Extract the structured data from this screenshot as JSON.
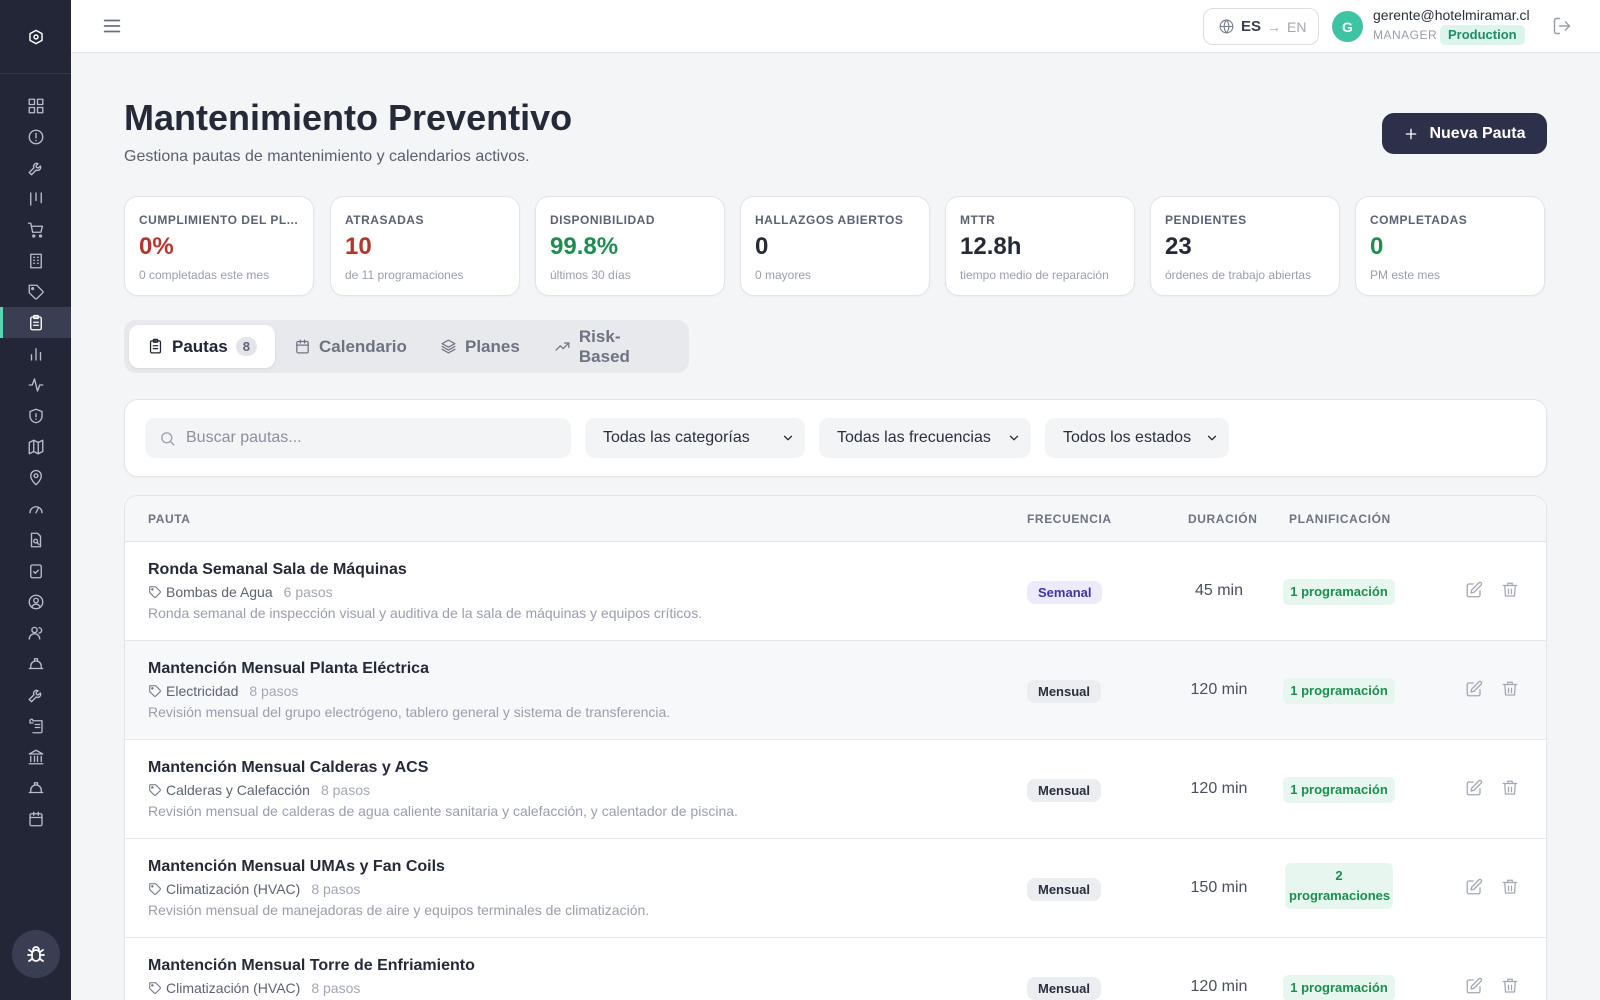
{
  "topbar": {
    "lang_current": "ES",
    "lang_arrow": "→",
    "lang_next": "EN",
    "avatar_initial": "G",
    "user_email": "gerente@hotelmiramar.cl",
    "user_role": "MANAGER",
    "env_badge": "Production"
  },
  "page": {
    "title": "Mantenimiento Preventivo",
    "subtitle": "Gestiona pautas de mantenimiento y calendarios activos.",
    "new_button": "Nueva Pauta"
  },
  "kpis": [
    {
      "label": "CUMPLIMIENTO DEL PL...",
      "value": "0%",
      "sub": "0 completadas este mes",
      "color": "#b3362d"
    },
    {
      "label": "ATRASADAS",
      "value": "10",
      "sub": "de 11 programaciones",
      "color": "#b3362d"
    },
    {
      "label": "DISPONIBILIDAD",
      "value": "99.8%",
      "sub": "últimos 30 días",
      "color": "#1f8c50"
    },
    {
      "label": "HALLAZGOS ABIERTOS",
      "value": "0",
      "sub": "0 mayores",
      "color": "#262a38"
    },
    {
      "label": "MTTR",
      "value": "12.8h",
      "sub": "tiempo medio de reparación",
      "color": "#262a38"
    },
    {
      "label": "PENDIENTES",
      "value": "23",
      "sub": "órdenes de trabajo abiertas",
      "color": "#262a38"
    },
    {
      "label": "COMPLETADAS",
      "value": "0",
      "sub": "PM este mes",
      "color": "#1f8c50"
    }
  ],
  "tabs": [
    {
      "label": "Pautas",
      "count": "8",
      "icon": "clipboard-icon"
    },
    {
      "label": "Calendario",
      "icon": "calendar-icon"
    },
    {
      "label": "Planes",
      "icon": "layers-icon"
    },
    {
      "label": "Risk-Based",
      "icon": "trending-up-icon"
    }
  ],
  "filters": {
    "search_placeholder": "Buscar pautas...",
    "category": "Todas las categorías",
    "frequency": "Todas las frecuencias",
    "status": "Todos los estados"
  },
  "table": {
    "headers": {
      "pauta": "PAUTA",
      "frecuencia": "FRECUENCIA",
      "duracion": "DURACIÓN",
      "planificacion": "PLANIFICACIÓN"
    },
    "rows": [
      {
        "name": "Ronda Semanal Sala de Máquinas",
        "category": "Bombas de Agua",
        "steps": "6 pasos",
        "desc": "Ronda semanal de inspección visual y auditiva de la sala de máquinas y equipos críticos.",
        "freq": "Semanal",
        "duration": "45 min",
        "plan": "1 programación"
      },
      {
        "name": "Mantención Mensual Planta Eléctrica",
        "category": "Electricidad",
        "steps": "8 pasos",
        "desc": "Revisión mensual del grupo electrógeno, tablero general y sistema de transferencia.",
        "freq": "Mensual",
        "duration": "120 min",
        "plan": "1 programación"
      },
      {
        "name": "Mantención Mensual Calderas y ACS",
        "category": "Calderas y Calefacción",
        "steps": "8 pasos",
        "desc": "Revisión mensual de calderas de agua caliente sanitaria y calefacción, y calentador de piscina.",
        "freq": "Mensual",
        "duration": "120 min",
        "plan": "1 programación"
      },
      {
        "name": "Mantención Mensual UMAs y Fan Coils",
        "category": "Climatización (HVAC)",
        "steps": "8 pasos",
        "desc": "Revisión mensual de manejadoras de aire y equipos terminales de climatización.",
        "freq": "Mensual",
        "duration": "150 min",
        "plan_line1": "2",
        "plan_line2": "programaciones"
      },
      {
        "name": "Mantención Mensual Torre de Enfriamiento",
        "category": "Climatización (HVAC)",
        "steps": "8 pasos",
        "desc": "",
        "freq": "Mensual",
        "duration": "120 min",
        "plan": "1 programación"
      }
    ]
  }
}
